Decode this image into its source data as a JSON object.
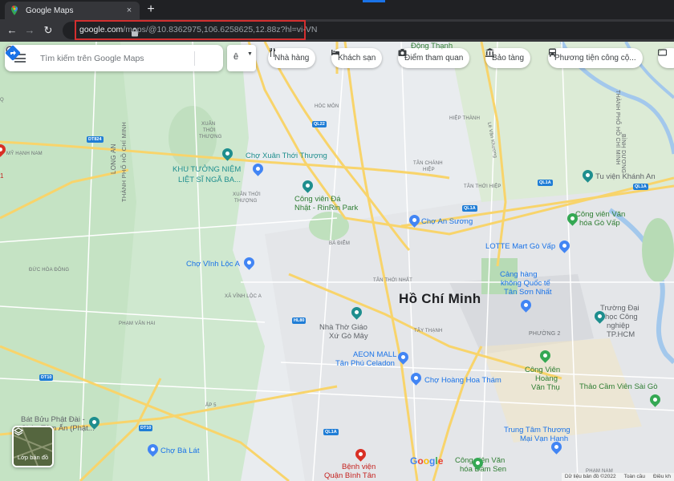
{
  "browser": {
    "tab_title": "Google Maps",
    "tab_close": "×",
    "new_tab": "+",
    "url_host": "google.com",
    "url_path": "/maps/@10.8362975,106.6258625,12.88z?hl=vi-VN",
    "nav": {
      "back": "←",
      "forward": "→",
      "reload": "↻"
    }
  },
  "search": {
    "placeholder": "Tìm kiếm trên Google Maps",
    "lang_glyph": "ê",
    "lang_caret": "▼"
  },
  "chips": [
    {
      "label": "Nhà hàng",
      "icon": "fork-knife-icon"
    },
    {
      "label": "Khách sạn",
      "icon": "bed-icon"
    },
    {
      "label": "Điểm tham quan",
      "icon": "camera-icon"
    },
    {
      "label": "Bảo tàng",
      "icon": "museum-icon"
    },
    {
      "label": "Phương tiện công cộ...",
      "icon": "bus-icon"
    }
  ],
  "map": {
    "city": "Hồ Chí Minh",
    "places": {
      "cho_xuan_thoi_thuong": "Chợ Xuân Thới Thượng",
      "khu_tuong_niem": "KHU TƯỞNG NIỆM",
      "liet_si": "LIỆT SĨ NGÃ BA...",
      "cong_vien_da_nhat_1": "Công viên Đá",
      "cong_vien_da_nhat_2": "Nhật - RinRin Park",
      "cho_an_suong": "Chợ An Sương",
      "cho_vinh_loc": "Chợ Vĩnh Lộc A",
      "lotte": "LOTTE Mart Gò Vấp",
      "cong_vien_van_hoa_1": "Công viên Văn",
      "cong_vien_van_hoa_2": "hóa Gò Vấp",
      "san_bay_1": "Cảng hàng",
      "san_bay_2": "không Quốc tế",
      "san_bay_3": "Tân Sơn Nhất",
      "nha_tho_1": "Nhà Thờ Giáo",
      "nha_tho_2": "Xứ Gò Mây",
      "aeon_1": "AEON MALL",
      "aeon_2": "Tân Phú Celadon",
      "cho_hoang_hoa_tham": "Chợ Hoàng Hoa Thám",
      "cv_hoang_van_thu_1": "Công Viên",
      "cv_hoang_van_thu_2": "Hoàng",
      "cv_hoang_van_thu_3": "Văn Thụ",
      "truong_dh_1": "Trường Đại",
      "truong_dh_2": "học Công",
      "truong_dh_3": "nghiệp",
      "truong_dh_4": "TP.HCM",
      "thao_cam_vien": "Thảo Cầm Viên Sài Gò",
      "trung_tam_tm_1": "Trung Tâm Thương",
      "trung_tam_tm_2": "Mại Vạn Hạnh",
      "benh_vien_1": "Bệnh viện",
      "benh_vien_2": "Quận Bình Tân",
      "cong_vien_van_hoa_dam_sen": "Công viên Văn",
      "dam_sen_2": "hóa Đầm Sen",
      "bat_buu_1": "Bát Bửu Phật Đài -",
      "bat_buu_2": "Chùa Tâm Ấn (Phật...",
      "cho_ba_lat": "Chợ Bà Lát",
      "tu_vien": "Tu viện Khánh An",
      "dong_thanh": "Động Thạnh"
    },
    "areas": {
      "hoc_mon": "HÓC MÔN",
      "hiep_thanh": "HIỆP THÀNH",
      "tan_chanh_hiep_1": "TÂN CHÁNH",
      "tan_chanh_hiep_2": "HIỆP",
      "tan_thoi_hiep": "TÂN THỚI HIỆP",
      "ba_diem": "BÀ ĐIỂM",
      "tan_thoi_nhat": "TÂN THỚI NHẤT",
      "tay_thanh": "TÂY THẠNH",
      "phuong_2": "PHƯỜNG 2",
      "xa_vinh_loc_a": "XÃ VĨNH LỘC A",
      "pham_van_hai": "PHẠM VĂN HAI",
      "duc_hoa_dong": "ĐỨC HÒA ĐÔNG",
      "my_hanh_nam": "MỸ HẠNH NAM",
      "xuan_thoi_thuong_1": "XUÂN",
      "xuan_thoi_thuong_2": "THỚI",
      "xuan_thoi_thuong_3": "THƯỢNG",
      "tan_thoi_thuong_1": "XUÂN THỚI",
      "tan_thoi_thuong_2": "THƯỢNG",
      "ap_5": "ẤP 5",
      "long_an": "LONG AN",
      "tp_hcm_vert": "THÀNH PHỐ HỒ CHÍ MINH",
      "binh_duong": "BÌNH DƯƠNG",
      "tp_hcm_vert2": "THÀNH PHỐ HỒ CHÍ MINH",
      "le_van_khuong": "Lê Văn Khương",
      "pham_nam": "PHẠM NAM",
      "q": "Q"
    },
    "roads": {
      "ql22": "QL22",
      "ql1a_1": "QL1A",
      "ql1a_2": "QL1A",
      "ql1a_3": "QL1A",
      "ql1a_4": "QL1A",
      "dt824": "DT824",
      "dt10": "DT10",
      "dt10b": "DT10",
      "hl80": "HL80"
    },
    "layers_label": "Lớp bản đồ",
    "google_logo": [
      "G",
      "o",
      "o",
      "g",
      "l",
      "e"
    ],
    "footer": [
      "Dữ liệu bản đồ ©2022",
      "Toàn cầu",
      "Điều kh"
    ]
  },
  "colors": {
    "omnibox_highlight": "#d32f2f",
    "accent": "#1a73e8",
    "water": "#aadaff",
    "park": "#c8e6c9",
    "major_road": "#f8d46b"
  }
}
